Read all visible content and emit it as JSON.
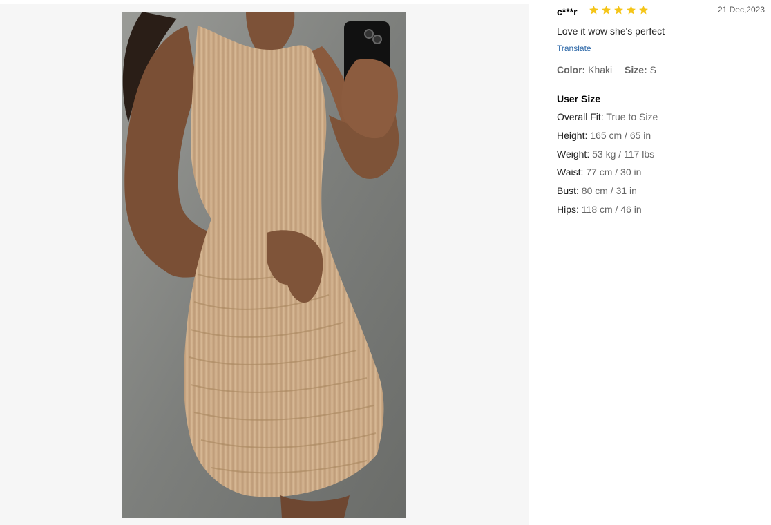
{
  "review": {
    "username": "c***r",
    "rating": 5,
    "date": "21 Dec,2023",
    "comment": "Love it wow she's perfect",
    "translate_label": "Translate",
    "color_label": "Color:",
    "color_value": "Khaki",
    "size_label": "Size:",
    "size_value": "S",
    "user_size_title": "User Size",
    "user_size": [
      {
        "label": "Overall Fit:",
        "value": "True to Size"
      },
      {
        "label": "Height:",
        "value": "165 cm / 65 in"
      },
      {
        "label": "Weight:",
        "value": "53 kg / 117 lbs"
      },
      {
        "label": "Waist:",
        "value": "77 cm / 30 in"
      },
      {
        "label": "Bust:",
        "value": "80 cm / 31 in"
      },
      {
        "label": "Hips:",
        "value": "118 cm / 46 in"
      }
    ]
  },
  "colors": {
    "star": "#f5c518",
    "link": "#2d68a8",
    "viewer_bg": "#f6f6f6",
    "dress": "#cfae8a"
  },
  "icons": {
    "star": "star-icon"
  }
}
